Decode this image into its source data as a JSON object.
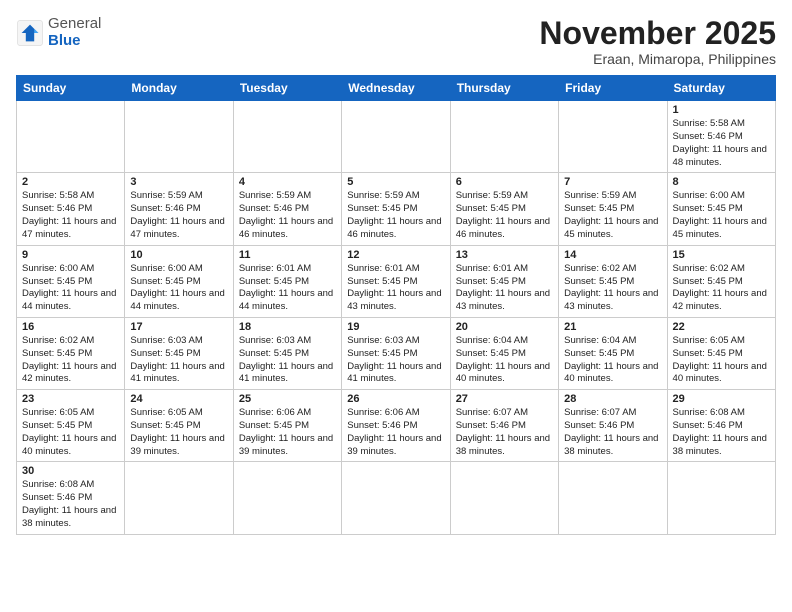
{
  "header": {
    "logo_general": "General",
    "logo_blue": "Blue",
    "month_title": "November 2025",
    "location": "Eraan, Mimaropa, Philippines"
  },
  "days_of_week": [
    "Sunday",
    "Monday",
    "Tuesday",
    "Wednesday",
    "Thursday",
    "Friday",
    "Saturday"
  ],
  "weeks": [
    [
      {
        "day": "",
        "info": ""
      },
      {
        "day": "",
        "info": ""
      },
      {
        "day": "",
        "info": ""
      },
      {
        "day": "",
        "info": ""
      },
      {
        "day": "",
        "info": ""
      },
      {
        "day": "",
        "info": ""
      },
      {
        "day": "1",
        "info": "Sunrise: 5:58 AM\nSunset: 5:46 PM\nDaylight: 11 hours and 48 minutes."
      }
    ],
    [
      {
        "day": "2",
        "info": "Sunrise: 5:58 AM\nSunset: 5:46 PM\nDaylight: 11 hours and 47 minutes."
      },
      {
        "day": "3",
        "info": "Sunrise: 5:59 AM\nSunset: 5:46 PM\nDaylight: 11 hours and 47 minutes."
      },
      {
        "day": "4",
        "info": "Sunrise: 5:59 AM\nSunset: 5:46 PM\nDaylight: 11 hours and 46 minutes."
      },
      {
        "day": "5",
        "info": "Sunrise: 5:59 AM\nSunset: 5:45 PM\nDaylight: 11 hours and 46 minutes."
      },
      {
        "day": "6",
        "info": "Sunrise: 5:59 AM\nSunset: 5:45 PM\nDaylight: 11 hours and 46 minutes."
      },
      {
        "day": "7",
        "info": "Sunrise: 5:59 AM\nSunset: 5:45 PM\nDaylight: 11 hours and 45 minutes."
      },
      {
        "day": "8",
        "info": "Sunrise: 6:00 AM\nSunset: 5:45 PM\nDaylight: 11 hours and 45 minutes."
      }
    ],
    [
      {
        "day": "9",
        "info": "Sunrise: 6:00 AM\nSunset: 5:45 PM\nDaylight: 11 hours and 44 minutes."
      },
      {
        "day": "10",
        "info": "Sunrise: 6:00 AM\nSunset: 5:45 PM\nDaylight: 11 hours and 44 minutes."
      },
      {
        "day": "11",
        "info": "Sunrise: 6:01 AM\nSunset: 5:45 PM\nDaylight: 11 hours and 44 minutes."
      },
      {
        "day": "12",
        "info": "Sunrise: 6:01 AM\nSunset: 5:45 PM\nDaylight: 11 hours and 43 minutes."
      },
      {
        "day": "13",
        "info": "Sunrise: 6:01 AM\nSunset: 5:45 PM\nDaylight: 11 hours and 43 minutes."
      },
      {
        "day": "14",
        "info": "Sunrise: 6:02 AM\nSunset: 5:45 PM\nDaylight: 11 hours and 43 minutes."
      },
      {
        "day": "15",
        "info": "Sunrise: 6:02 AM\nSunset: 5:45 PM\nDaylight: 11 hours and 42 minutes."
      }
    ],
    [
      {
        "day": "16",
        "info": "Sunrise: 6:02 AM\nSunset: 5:45 PM\nDaylight: 11 hours and 42 minutes."
      },
      {
        "day": "17",
        "info": "Sunrise: 6:03 AM\nSunset: 5:45 PM\nDaylight: 11 hours and 41 minutes."
      },
      {
        "day": "18",
        "info": "Sunrise: 6:03 AM\nSunset: 5:45 PM\nDaylight: 11 hours and 41 minutes."
      },
      {
        "day": "19",
        "info": "Sunrise: 6:03 AM\nSunset: 5:45 PM\nDaylight: 11 hours and 41 minutes."
      },
      {
        "day": "20",
        "info": "Sunrise: 6:04 AM\nSunset: 5:45 PM\nDaylight: 11 hours and 40 minutes."
      },
      {
        "day": "21",
        "info": "Sunrise: 6:04 AM\nSunset: 5:45 PM\nDaylight: 11 hours and 40 minutes."
      },
      {
        "day": "22",
        "info": "Sunrise: 6:05 AM\nSunset: 5:45 PM\nDaylight: 11 hours and 40 minutes."
      }
    ],
    [
      {
        "day": "23",
        "info": "Sunrise: 6:05 AM\nSunset: 5:45 PM\nDaylight: 11 hours and 40 minutes."
      },
      {
        "day": "24",
        "info": "Sunrise: 6:05 AM\nSunset: 5:45 PM\nDaylight: 11 hours and 39 minutes."
      },
      {
        "day": "25",
        "info": "Sunrise: 6:06 AM\nSunset: 5:45 PM\nDaylight: 11 hours and 39 minutes."
      },
      {
        "day": "26",
        "info": "Sunrise: 6:06 AM\nSunset: 5:46 PM\nDaylight: 11 hours and 39 minutes."
      },
      {
        "day": "27",
        "info": "Sunrise: 6:07 AM\nSunset: 5:46 PM\nDaylight: 11 hours and 38 minutes."
      },
      {
        "day": "28",
        "info": "Sunrise: 6:07 AM\nSunset: 5:46 PM\nDaylight: 11 hours and 38 minutes."
      },
      {
        "day": "29",
        "info": "Sunrise: 6:08 AM\nSunset: 5:46 PM\nDaylight: 11 hours and 38 minutes."
      }
    ],
    [
      {
        "day": "30",
        "info": "Sunrise: 6:08 AM\nSunset: 5:46 PM\nDaylight: 11 hours and 38 minutes."
      },
      {
        "day": "",
        "info": ""
      },
      {
        "day": "",
        "info": ""
      },
      {
        "day": "",
        "info": ""
      },
      {
        "day": "",
        "info": ""
      },
      {
        "day": "",
        "info": ""
      },
      {
        "day": "",
        "info": ""
      }
    ]
  ]
}
